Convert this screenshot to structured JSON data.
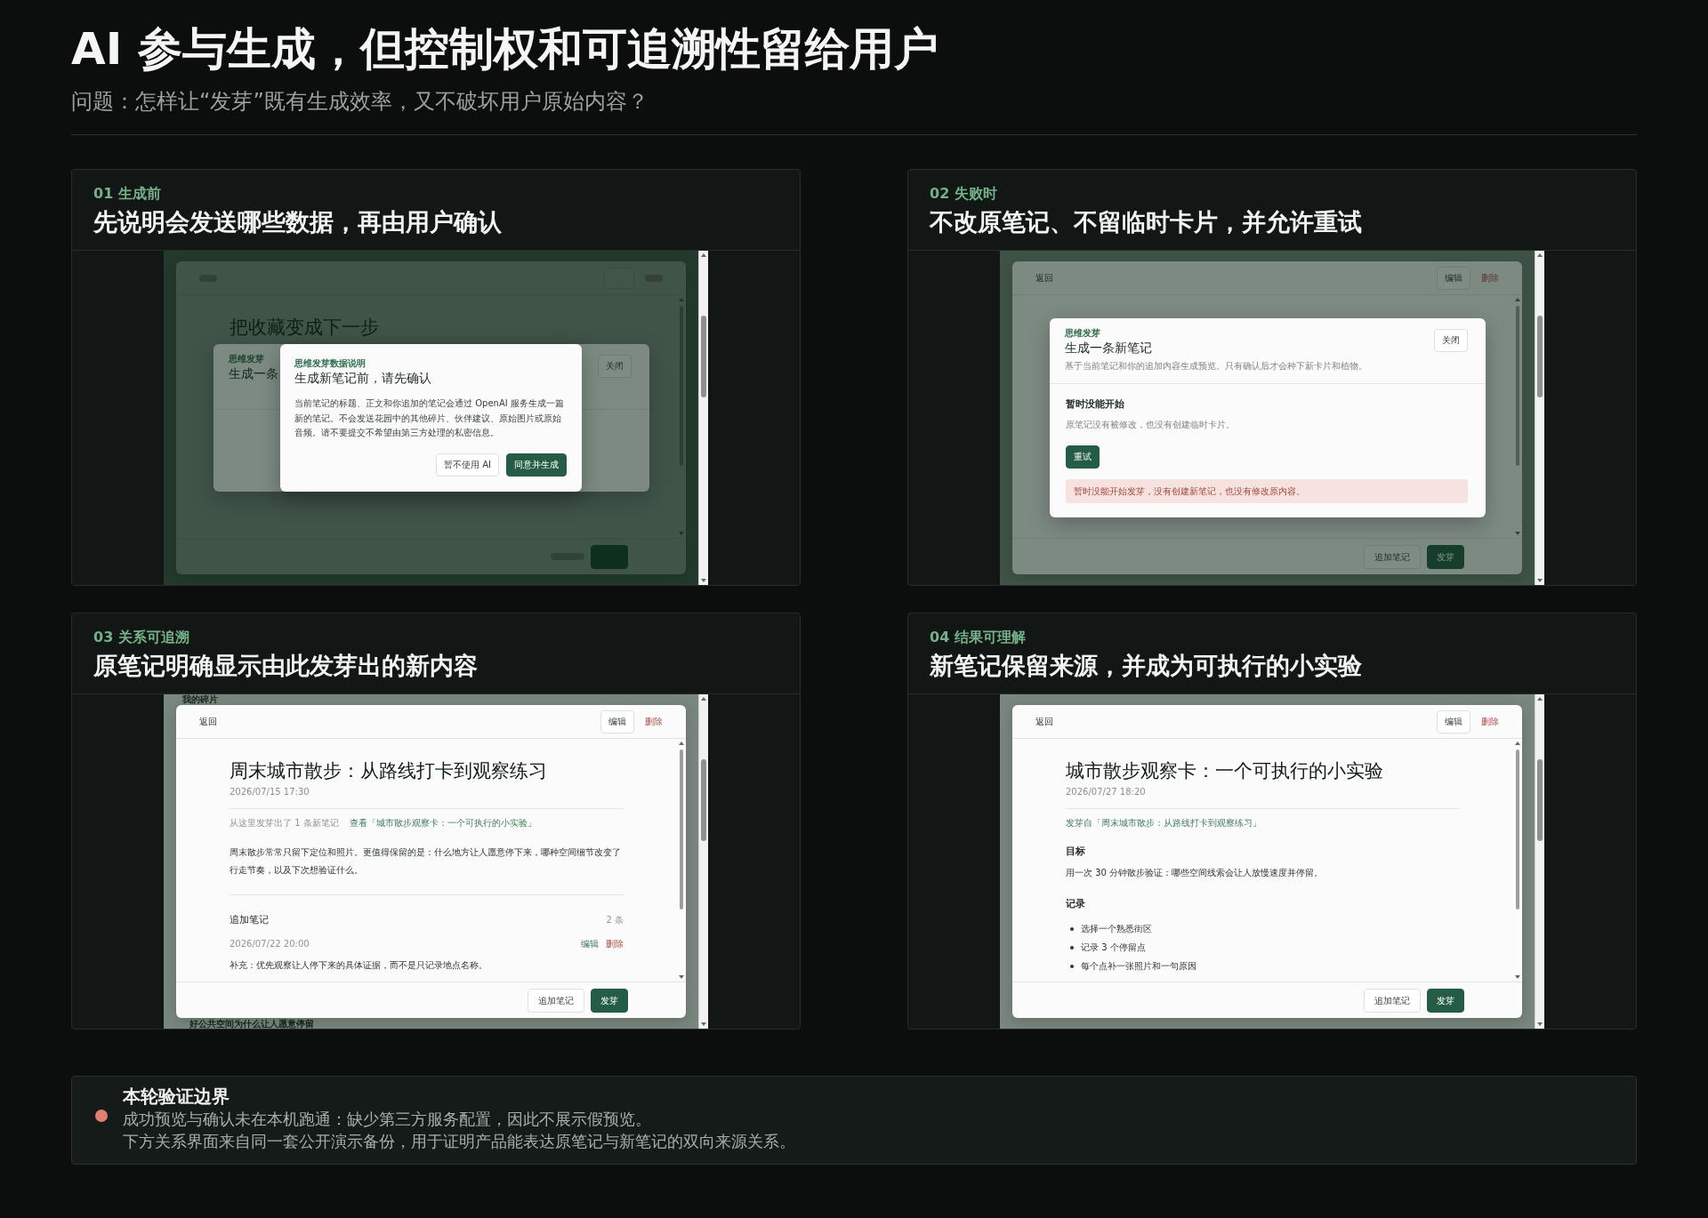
{
  "header": {
    "title": "AI 参与生成，但控制权和可追溯性留给用户",
    "subtitle": "问题：怎样让“发芽”既有生成效率，又不破坏用户原始内容？"
  },
  "panels": [
    {
      "step": "01 生成前",
      "heading": "先说明会发送哪些数据，再由用户确认",
      "screen": {
        "layers": [
          {
            "kind": "page"
          },
          {
            "kind": "blurred_note",
            "title": "把收藏变成下一步"
          },
          {
            "kind": "dialog",
            "eyebrow": "思维发芽",
            "title": "生成一条",
            "close": "关闭"
          },
          {
            "kind": "confirm",
            "eyebrow": "思维发芽数据说明",
            "title": "生成新笔记前，请先确认",
            "text": "当前笔记的标题、正文和你追加的笔记会通过 OpenAI 服务生成一篇新的笔记。不会发送花园中的其他碎片、伙伴建议、原始图片或原始音频。请不要提交不希望由第三方处理的私密信息。",
            "buttons": [
              {
                "label": "暂不使用 AI",
                "kind": "secondary"
              },
              {
                "label": "同意并生成",
                "kind": "primary"
              }
            ]
          }
        ]
      }
    },
    {
      "step": "02 失败时",
      "heading": "不改原笔记、不留临时卡片，并允许重试",
      "screen": {
        "layers": [
          {
            "kind": "page"
          },
          {
            "kind": "note",
            "back": "返回",
            "edit": "编辑",
            "delete": "删除",
            "footer": [
              {
                "label": "追加笔记",
                "kind": "secondary"
              },
              {
                "label": "发芽",
                "kind": "primary"
              }
            ]
          },
          {
            "kind": "dialog",
            "eyebrow": "思维发芽",
            "title": "生成一条新笔记",
            "subtitle": "基于当前笔记和你的追加内容生成预览。只有确认后才会种下新卡片和植物。",
            "close": "关闭",
            "status": "暂时没能开始",
            "status_text": "原笔记没有被修改，也没有创建临时卡片。",
            "action": "重试",
            "alert": "暂时没能开始发芽，没有创建新笔记，也没有修改原内容。"
          }
        ]
      }
    },
    {
      "step": "03 关系可追溯",
      "heading": "原笔记明确显示由此发芽出的新内容",
      "screen": {
        "layers": [
          {
            "kind": "page",
            "top_text": "我的碎片",
            "bottom_text": "好公共空间为什么让人愿意停留"
          },
          {
            "kind": "note",
            "back": "返回",
            "edit": "编辑",
            "delete": "删除",
            "title": "周末城市散步：从路线打卡到观察练习",
            "date": "2026/07/15 17:30",
            "blocks": [
              {
                "kind": "origin",
                "parts": [
                  {
                    "text": "从这里发芽出了 1 条新笔记",
                    "link": false
                  },
                  {
                    "text": "查看「城市散步观察卡：一个可执行的小实验」",
                    "link": true
                  }
                ]
              },
              {
                "kind": "paragraph",
                "text": "周末散步常常只留下定位和照片。更值得保留的是：什么地方让人愿意停下来，哪种空间细节改变了行走节奏，以及下次想验证什么。"
              },
              {
                "kind": "addendum",
                "heading": "追加笔记",
                "count": "2 条",
                "entries": [
                  {
                    "date": "2026/07/22 20:00",
                    "edit": "编辑",
                    "delete": "删除",
                    "text": "补充：优先观察让人停下来的具体证据，而不是只记录地点名称。"
                  }
                ]
              }
            ],
            "footer": [
              {
                "label": "追加笔记",
                "kind": "secondary"
              },
              {
                "label": "发芽",
                "kind": "primary"
              }
            ]
          }
        ]
      }
    },
    {
      "step": "04 结果可理解",
      "heading": "新笔记保留来源，并成为可执行的小实验",
      "screen": {
        "layers": [
          {
            "kind": "page"
          },
          {
            "kind": "note",
            "back": "返回",
            "edit": "编辑",
            "delete": "删除",
            "title": "城市散步观察卡：一个可执行的小实验",
            "date": "2026/07/27 18:20",
            "blocks": [
              {
                "kind": "origin",
                "parts": [
                  {
                    "text": "发芽自「周末城市散步：从路线打卡到观察练习」",
                    "link": true
                  }
                ]
              },
              {
                "kind": "heading",
                "text": "目标"
              },
              {
                "kind": "paragraph",
                "text": "用一次 30 分钟散步验证：哪些空间线索会让人放慢速度并停留。"
              },
              {
                "kind": "heading",
                "text": "记录"
              },
              {
                "kind": "list",
                "items": [
                  "选择一个熟悉街区",
                  "记录 3 个停留点",
                  "每个点补一张照片和一句原因"
                ]
              }
            ],
            "footer": [
              {
                "label": "追加笔记",
                "kind": "secondary"
              },
              {
                "label": "发芽",
                "kind": "primary"
              }
            ]
          }
        ]
      }
    }
  ],
  "notice": {
    "title": "本轮验证边界",
    "lines": [
      "成功预览与确认未在本机跑通：缺少第三方服务配置，因此不展示假预览。",
      "下方关系界面来自同一套公开演示备份，用于证明产品能表达原笔记与新笔记的双向来源关系。"
    ]
  }
}
